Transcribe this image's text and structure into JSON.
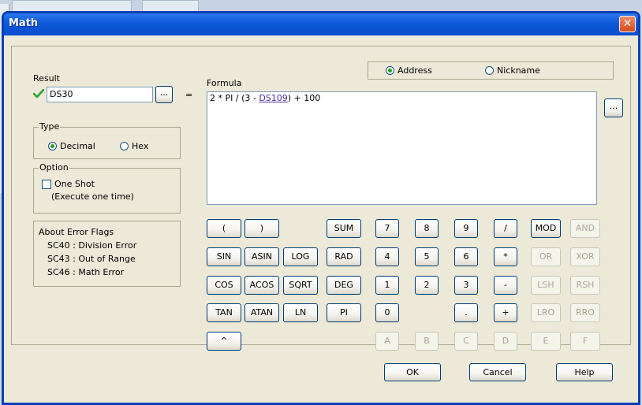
{
  "window": {
    "title": "Math",
    "close_glyph": "✕"
  },
  "source_select": {
    "options": [
      {
        "label": "Address",
        "selected": true
      },
      {
        "label": "Nickname",
        "selected": false
      }
    ]
  },
  "result": {
    "label": "Result",
    "status_icon": "check-icon",
    "value": "DS30",
    "browse_label": "...",
    "equals": "="
  },
  "formula": {
    "label": "Formula",
    "prefix": "2 * PI / (3 - ",
    "link": "DS109",
    "suffix": ") + 100",
    "browse_label": "..."
  },
  "type_group": {
    "title": "Type",
    "options": [
      {
        "label": "Decimal",
        "selected": true
      },
      {
        "label": "Hex",
        "selected": false
      }
    ]
  },
  "option_group": {
    "title": "Option",
    "checkbox_label": "One Shot",
    "checkbox_checked": false,
    "checkbox_note": "(Execute one time)"
  },
  "error_flags": {
    "title": "About Error Flags",
    "lines": [
      "SC40 : Division Error",
      "SC43 : Out of Range",
      "SC46 : Math Error"
    ]
  },
  "keypad": {
    "rows": [
      [
        "(",
        ")",
        "",
        "SUM",
        "7",
        "8",
        "9",
        "/",
        "MOD",
        "AND"
      ],
      [
        "SIN",
        "ASIN",
        "LOG",
        "RAD",
        "4",
        "5",
        "6",
        "*",
        "OR",
        "XOR"
      ],
      [
        "COS",
        "ACOS",
        "SQRT",
        "DEG",
        "1",
        "2",
        "3",
        "-",
        "LSH",
        "RSH"
      ],
      [
        "TAN",
        "ATAN",
        "LN",
        "PI",
        "0",
        "",
        ".",
        "+",
        "LRO",
        "RRO"
      ],
      [
        "^",
        "",
        "",
        "",
        "A",
        "B",
        "C",
        "D",
        "E",
        "F"
      ]
    ],
    "disabled": [
      "AND",
      "OR",
      "XOR",
      "LSH",
      "RSH",
      "LRO",
      "RRO",
      "A",
      "B",
      "C",
      "D",
      "E",
      "F"
    ]
  },
  "buttons": {
    "ok": "OK",
    "cancel": "Cancel",
    "help": "Help"
  },
  "colors": {
    "title_bar": "#0b58d8",
    "dialog_bg": "#ece9d8",
    "check_green": "#2fa12f",
    "link_purple": "#4a2fa0",
    "close_red": "#d64a1e"
  }
}
